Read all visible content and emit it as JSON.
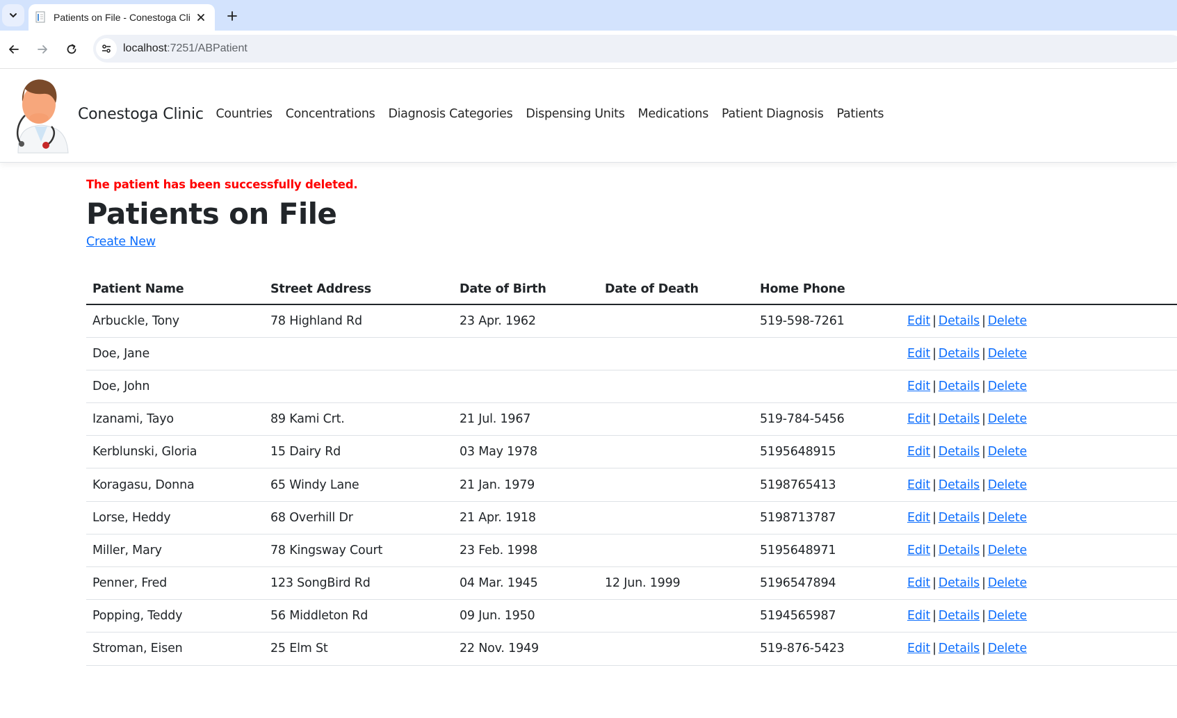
{
  "browser": {
    "tab_title": "Patients on File - Conestoga Clinic",
    "url_host": "localhost",
    "url_rest": ":7251/ABPatient"
  },
  "navbar": {
    "brand": "Conestoga Clinic",
    "links": [
      "Countries",
      "Concentrations",
      "Diagnosis Categories",
      "Dispensing Units",
      "Medications",
      "Patient Diagnosis",
      "Patients"
    ]
  },
  "page": {
    "alert": "The patient has been successfully deleted.",
    "title": "Patients on File",
    "create_new": "Create New"
  },
  "table": {
    "headers": [
      "Patient Name",
      "Street Address",
      "Date of Birth",
      "Date of Death",
      "Home Phone"
    ],
    "actions": {
      "edit": "Edit",
      "details": "Details",
      "delete": "Delete",
      "separator": "|"
    },
    "rows": [
      {
        "name": "Arbuckle, Tony",
        "address": "78 Highland Rd",
        "dob": "23 Apr. 1962",
        "dod": "",
        "phone": "519-598-7261"
      },
      {
        "name": "Doe, Jane",
        "address": "",
        "dob": "",
        "dod": "",
        "phone": ""
      },
      {
        "name": "Doe, John",
        "address": "",
        "dob": "",
        "dod": "",
        "phone": ""
      },
      {
        "name": "Izanami, Tayo",
        "address": "89 Kami Crt.",
        "dob": "21 Jul. 1967",
        "dod": "",
        "phone": "519-784-5456"
      },
      {
        "name": "Kerblunski, Gloria",
        "address": "15 Dairy Rd",
        "dob": "03 May 1978",
        "dod": "",
        "phone": "5195648915"
      },
      {
        "name": "Koragasu, Donna",
        "address": "65 Windy Lane",
        "dob": "21 Jan. 1979",
        "dod": "",
        "phone": "5198765413"
      },
      {
        "name": "Lorse, Heddy",
        "address": "68 Overhill Dr",
        "dob": "21 Apr. 1918",
        "dod": "",
        "phone": "5198713787"
      },
      {
        "name": "Miller, Mary",
        "address": "78 Kingsway Court",
        "dob": "23 Feb. 1998",
        "dod": "",
        "phone": "5195648971"
      },
      {
        "name": "Penner, Fred",
        "address": "123 SongBird Rd",
        "dob": "04 Mar. 1945",
        "dod": "12 Jun. 1999",
        "phone": "5196547894"
      },
      {
        "name": "Popping, Teddy",
        "address": "56 Middleton Rd",
        "dob": "09 Jun. 1950",
        "dod": "",
        "phone": "5194565987"
      },
      {
        "name": "Stroman, Eisen",
        "address": "25 Elm St",
        "dob": "22 Nov. 1949",
        "dod": "",
        "phone": "519-876-5423"
      }
    ]
  },
  "colors": {
    "link": "#0d6efd",
    "alert": "#ff0000",
    "tabstrip": "#d3e3fd"
  },
  "icons": [
    "chevron-down-icon",
    "favicon-icon",
    "close-icon",
    "plus-icon",
    "back-arrow-icon",
    "forward-arrow-icon",
    "reload-icon",
    "site-settings-icon",
    "doctor-logo"
  ]
}
